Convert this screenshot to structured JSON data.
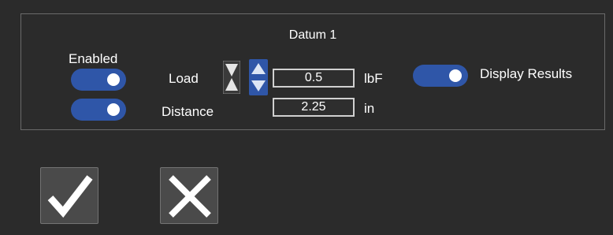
{
  "panel": {
    "title": "Datum 1",
    "enabled_label": "Enabled",
    "rows": [
      {
        "label": "Load",
        "value": "0.5",
        "unit": "lbF",
        "enabled": true
      },
      {
        "label": "Distance",
        "value": "2.25",
        "unit": "in",
        "enabled": true
      }
    ],
    "display_results": {
      "label": "Display Results",
      "on": true
    }
  },
  "actions": {
    "confirm": "check-icon",
    "cancel": "x-icon"
  },
  "colors": {
    "background": "#2b2b2b",
    "toggle_on": "#2f56a8",
    "spin_active": "#2f56a8"
  }
}
